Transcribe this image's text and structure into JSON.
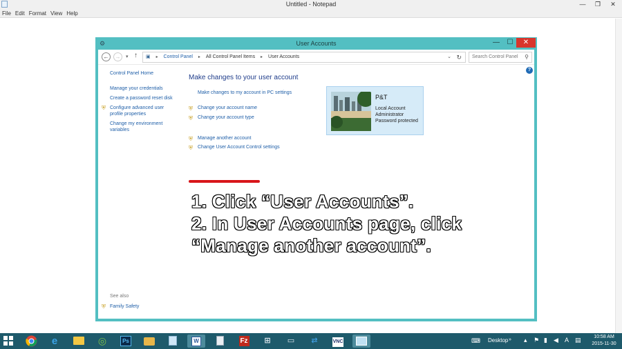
{
  "notepad": {
    "title": "Untitled - Notepad",
    "menu": [
      "File",
      "Edit",
      "Format",
      "View",
      "Help"
    ],
    "controls": {
      "min": "—",
      "max": "❐",
      "close": "✕"
    }
  },
  "user_accounts": {
    "title": "User Accounts",
    "controls": {
      "min": "—",
      "max": "☐",
      "close": "✕"
    },
    "breadcrumb": [
      "Control Panel",
      "All Control Panel Items",
      "User Accounts"
    ],
    "search_placeholder": "Search Control Panel",
    "sidebar": {
      "home": "Control Panel Home",
      "links": [
        "Manage your credentials",
        "Create a password reset disk",
        "Configure advanced user profile properties",
        "Change my environment variables"
      ],
      "see_also_label": "See also",
      "see_also": [
        "Family Safety"
      ]
    },
    "main": {
      "heading": "Make changes to your user account",
      "tasks": [
        "Make changes to my account in PC settings",
        "Change your account name",
        "Change your account type",
        "Manage another account",
        "Change User Account Control settings"
      ]
    },
    "account": {
      "name": "P&T",
      "lines": [
        "Local Account",
        "Administrator",
        "Password protected"
      ]
    }
  },
  "instructions": [
    "1. Click “User Accounts”.",
    "2. In User Accounts page, click",
    "“Manage another account”."
  ],
  "taskbar": {
    "apps": [
      "chrome",
      "internet-explorer",
      "file-explorer",
      "dreamweaver",
      "photoshop",
      "file-manager",
      "notepad",
      "word",
      "notepad-doc",
      "filezilla",
      "network",
      "remote-desktop",
      "teamviewer",
      "vnc",
      "control-panel"
    ],
    "tray": {
      "desktop_label": "Desktop",
      "lang": "A"
    },
    "time": "10:58 AM",
    "date": "2015-11-30"
  },
  "colors": {
    "window_frame": "#53bfc2",
    "link": "#1f5fa8",
    "heading": "#1e3c8a",
    "taskbar": "#1e5a6b",
    "close_button": "#d9352c",
    "highlight_underline": "#d8151a"
  }
}
